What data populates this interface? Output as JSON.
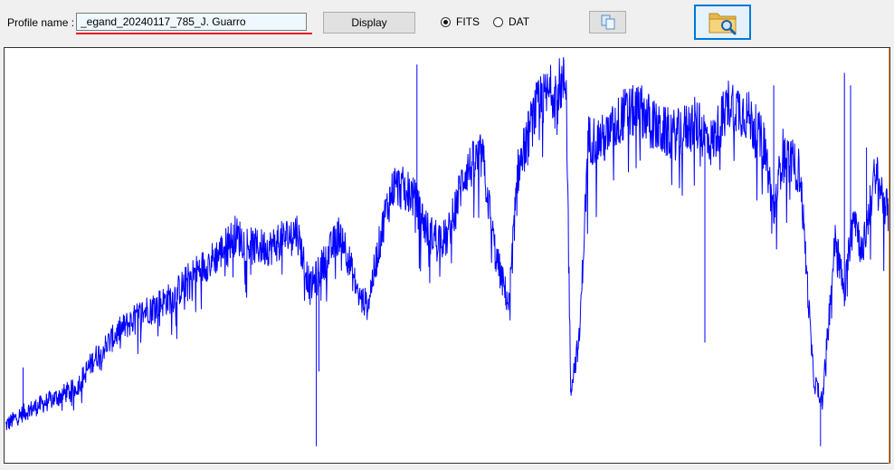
{
  "toolbar": {
    "profile_label": "Profile name :",
    "profile_value": "_egand_20240117_785_J. Guarro",
    "display_label": "Display",
    "format_options": [
      {
        "label": "FITS",
        "checked": true
      },
      {
        "label": "DAT",
        "checked": false
      }
    ],
    "copy_icon": "copy-icon",
    "browse_icon": "folder-search-icon"
  },
  "chart_data": {
    "type": "line",
    "title": "",
    "xlabel": "",
    "ylabel": "",
    "grid": false,
    "series_color": "#0000ff",
    "x_units": "relative position (0 = left edge, 1 = right edge)",
    "y_units": "relative flux (0 = bottom, 1 = top of plot)",
    "envelope": [
      [
        0.0,
        0.09
      ],
      [
        0.02,
        0.12
      ],
      [
        0.05,
        0.15
      ],
      [
        0.08,
        0.18
      ],
      [
        0.1,
        0.25
      ],
      [
        0.13,
        0.32
      ],
      [
        0.16,
        0.37
      ],
      [
        0.19,
        0.4
      ],
      [
        0.21,
        0.45
      ],
      [
        0.24,
        0.5
      ],
      [
        0.26,
        0.55
      ],
      [
        0.28,
        0.52
      ],
      [
        0.3,
        0.52
      ],
      [
        0.33,
        0.56
      ],
      [
        0.345,
        0.42
      ],
      [
        0.36,
        0.48
      ],
      [
        0.38,
        0.56
      ],
      [
        0.4,
        0.4
      ],
      [
        0.41,
        0.38
      ],
      [
        0.43,
        0.6
      ],
      [
        0.44,
        0.67
      ],
      [
        0.46,
        0.65
      ],
      [
        0.48,
        0.55
      ],
      [
        0.5,
        0.54
      ],
      [
        0.52,
        0.7
      ],
      [
        0.54,
        0.74
      ],
      [
        0.555,
        0.5
      ],
      [
        0.57,
        0.38
      ],
      [
        0.58,
        0.7
      ],
      [
        0.6,
        0.85
      ],
      [
        0.62,
        0.9
      ],
      [
        0.635,
        0.92
      ],
      [
        0.64,
        0.18
      ],
      [
        0.65,
        0.3
      ],
      [
        0.66,
        0.78
      ],
      [
        0.68,
        0.78
      ],
      [
        0.7,
        0.84
      ],
      [
        0.72,
        0.85
      ],
      [
        0.74,
        0.8
      ],
      [
        0.76,
        0.79
      ],
      [
        0.78,
        0.82
      ],
      [
        0.8,
        0.77
      ],
      [
        0.82,
        0.87
      ],
      [
        0.84,
        0.84
      ],
      [
        0.86,
        0.76
      ],
      [
        0.87,
        0.6
      ],
      [
        0.88,
        0.75
      ],
      [
        0.9,
        0.7
      ],
      [
        0.915,
        0.2
      ],
      [
        0.925,
        0.15
      ],
      [
        0.94,
        0.55
      ],
      [
        0.95,
        0.4
      ],
      [
        0.96,
        0.62
      ],
      [
        0.97,
        0.5
      ],
      [
        0.985,
        0.7
      ],
      [
        1.0,
        0.6
      ]
    ],
    "spikes": [
      {
        "x": 0.02,
        "y": 0.23
      },
      {
        "x": 0.355,
        "y": 0.22
      },
      {
        "x": 0.352,
        "y": 0.04
      },
      {
        "x": 0.466,
        "y": 0.96
      },
      {
        "x": 0.64,
        "y": 0.17
      },
      {
        "x": 0.792,
        "y": 0.29
      },
      {
        "x": 0.87,
        "y": 0.91
      },
      {
        "x": 0.923,
        "y": 0.04
      },
      {
        "x": 0.95,
        "y": 0.94
      },
      {
        "x": 0.957,
        "y": 0.91
      },
      {
        "x": 0.975,
        "y": 0.76
      }
    ]
  }
}
